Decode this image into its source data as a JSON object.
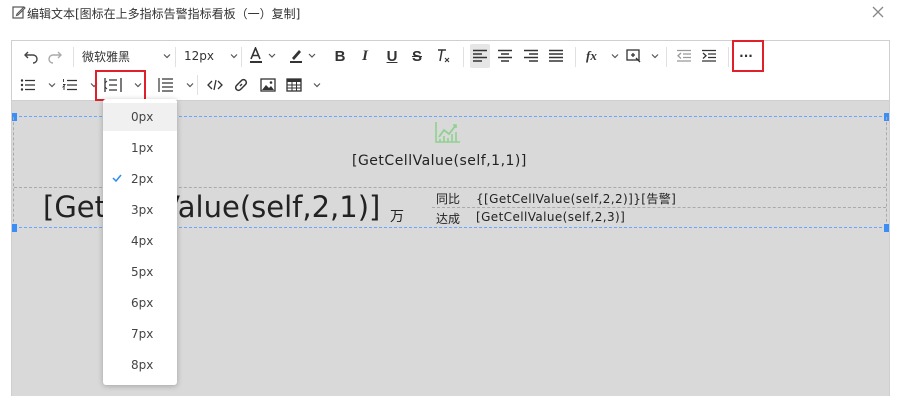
{
  "dialog": {
    "title": "编辑文本[图标在上多指标告警指标看板（一）复制]"
  },
  "toolbar": {
    "font_family": "微软雅黑",
    "font_size": "12px",
    "bold_label": "B",
    "italic_label": "I",
    "underline_label": "U",
    "strike_label": "S",
    "formula_label": "fx",
    "more_label": "···"
  },
  "line_height_dropdown": {
    "options": [
      "0px",
      "1px",
      "2px",
      "3px",
      "4px",
      "5px",
      "6px",
      "7px",
      "8px"
    ],
    "selected": "2px",
    "hovered": "0px"
  },
  "content": {
    "cell_1_1": "[GetCellValue(self,1,1)]",
    "cell_2_1": "[GetCellValue(self,2,1)]",
    "cell_2_1_unit": "万",
    "yoy_label": "同比",
    "cell_2_2": "{[GetCellValue(self,2,2)]}[告警]",
    "achieve_label": "达成",
    "cell_2_3": "[GetCellValue(self,2,3)]"
  },
  "colors": {
    "highlight": "#e0202b",
    "canvas_bg": "#d9d9d9",
    "selection": "#3a8ef6",
    "check": "#2d8cf0",
    "chart_icon": "#8fd18f"
  }
}
